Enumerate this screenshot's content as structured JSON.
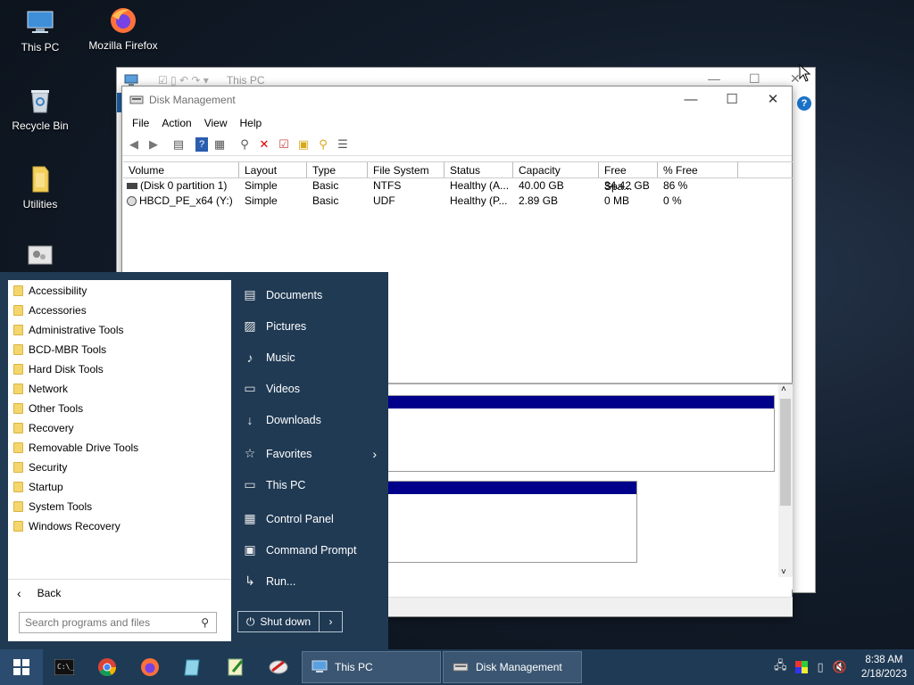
{
  "desktop": {
    "icons": [
      {
        "label": "This PC"
      },
      {
        "label": "Mozilla Firefox"
      },
      {
        "label": "Recycle Bin"
      },
      {
        "label": "Utilities"
      }
    ]
  },
  "back_window": {
    "title": "This PC"
  },
  "disk_management": {
    "title": "Disk Management",
    "menu": [
      "File",
      "Action",
      "View",
      "Help"
    ],
    "columns": [
      "Volume",
      "Layout",
      "Type",
      "File System",
      "Status",
      "Capacity",
      "Free Spa...",
      "% Free"
    ],
    "rows": [
      [
        "(Disk 0 partition 1)",
        "Simple",
        "Basic",
        "NTFS",
        "Healthy (A...",
        "40.00 GB",
        "34.42 GB",
        "86 %"
      ],
      [
        "HBCD_PE_x64 (Y:)",
        "Simple",
        "Basic",
        "UDF",
        "Healthy (P...",
        "2.89 GB",
        "0 MB",
        "0 %"
      ]
    ]
  },
  "start_menu": {
    "programs": [
      "Accessibility",
      "Accessories",
      "Administrative Tools",
      "BCD-MBR Tools",
      "Hard Disk Tools",
      "Network",
      "Other Tools",
      "Recovery",
      "Removable Drive Tools",
      "Security",
      "Startup",
      "System Tools",
      "Windows Recovery"
    ],
    "back_label": "Back",
    "search_placeholder": "Search programs and files",
    "places": [
      {
        "label": "Documents",
        "icon": "document-icon"
      },
      {
        "label": "Pictures",
        "icon": "picture-icon"
      },
      {
        "label": "Music",
        "icon": "music-icon"
      },
      {
        "label": "Videos",
        "icon": "video-icon"
      },
      {
        "label": "Downloads",
        "icon": "download-icon"
      },
      {
        "label": "Favorites",
        "icon": "star-icon"
      },
      {
        "label": "This PC",
        "icon": "monitor-icon"
      },
      {
        "label": "Control Panel",
        "icon": "control-panel-icon"
      },
      {
        "label": "Command Prompt",
        "icon": "terminal-icon"
      },
      {
        "label": "Run...",
        "icon": "run-icon"
      }
    ],
    "shutdown_label": "Shut down"
  },
  "taskbar": {
    "tasks": [
      {
        "label": "This PC"
      },
      {
        "label": "Disk Management"
      }
    ],
    "time": "8:38 AM",
    "date": "2/18/2023"
  }
}
